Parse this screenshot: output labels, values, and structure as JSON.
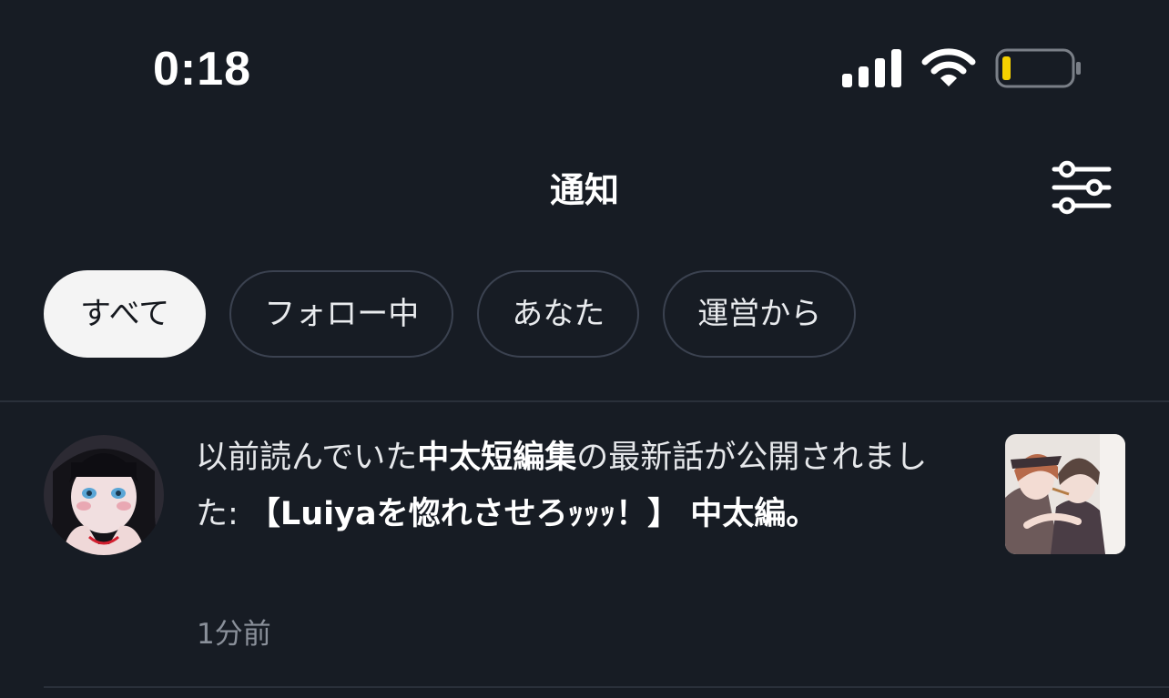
{
  "status_bar": {
    "time": "0:18",
    "battery_color": "#f5d100"
  },
  "header": {
    "title": "通知",
    "filter_icon": "sliders-icon"
  },
  "tabs": [
    {
      "label": "すべて",
      "active": true
    },
    {
      "label": "フォロー中",
      "active": false
    },
    {
      "label": "あなた",
      "active": false
    },
    {
      "label": "運営から",
      "active": false
    }
  ],
  "notifications": [
    {
      "text_prefix": "以前読んでいた",
      "work_title": "中太短編集",
      "text_middle": "の最新話が公開されました: ",
      "episode_title": "【Luiyaを惚れさせろｯｯｯ！】 中太編。",
      "time": "1分前"
    }
  ]
}
